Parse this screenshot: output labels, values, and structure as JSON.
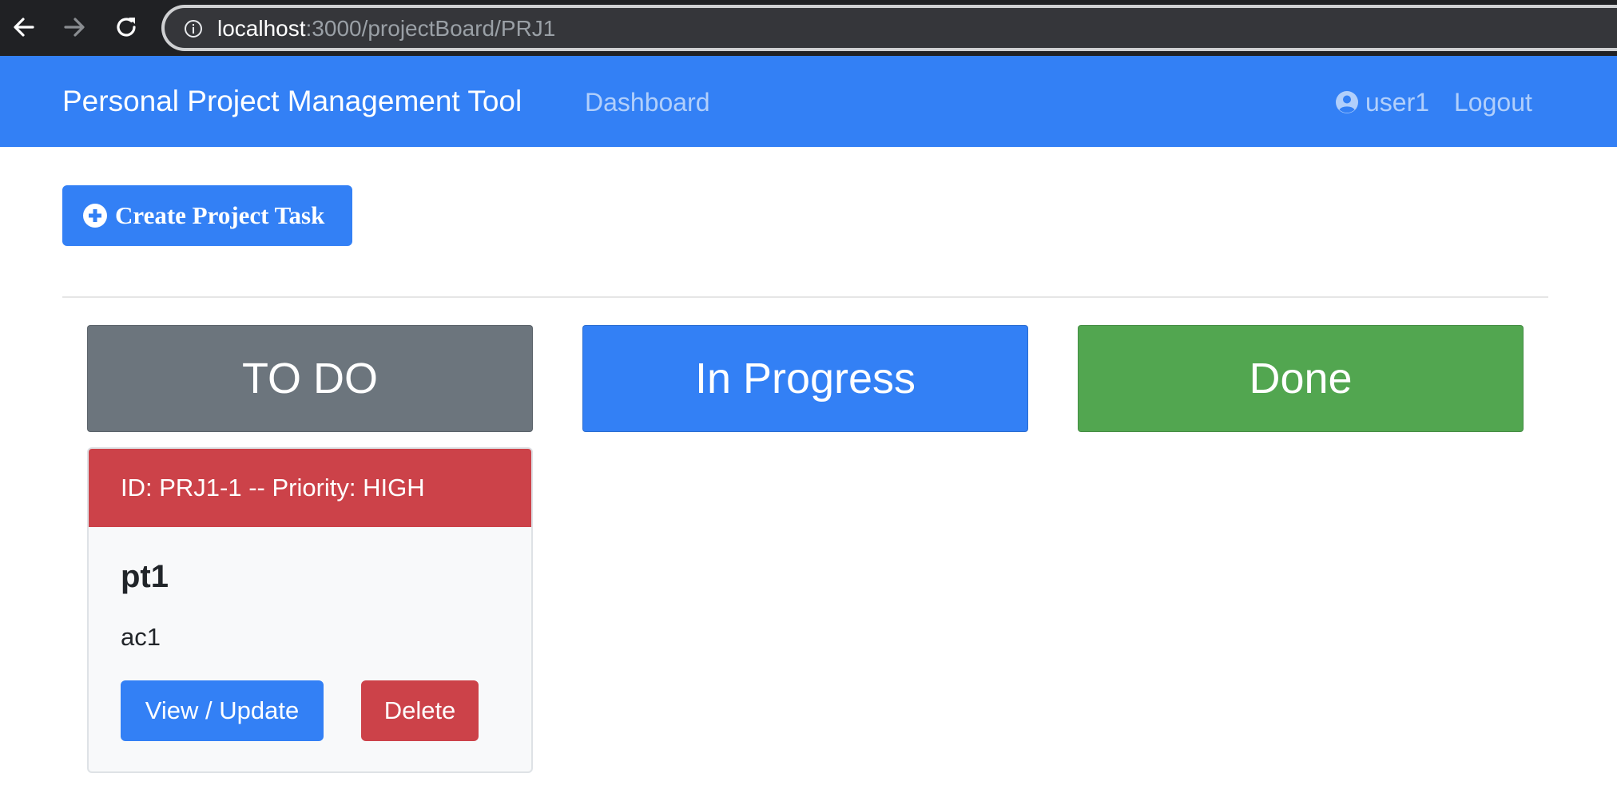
{
  "browser": {
    "url_host": "localhost",
    "url_path": ":3000/projectBoard/PRJ1"
  },
  "navbar": {
    "brand": "Personal Project Management Tool",
    "dashboard_label": "Dashboard",
    "username": "user1",
    "logout_label": "Logout",
    "background_color": "#3380f5"
  },
  "actions": {
    "create_task_label": "Create Project Task"
  },
  "columns": [
    {
      "label": "TO DO",
      "color": "#6c757d"
    },
    {
      "label": "In Progress",
      "color": "#3380f5"
    },
    {
      "label": "Done",
      "color": "#52a650"
    }
  ],
  "tasks": [
    {
      "header": "ID: PRJ1-1 -- Priority: HIGH",
      "summary": "pt1",
      "acceptance_criteria": "ac1",
      "view_label": "View / Update",
      "delete_label": "Delete",
      "priority_color": "#cc4249"
    }
  ],
  "icons": {
    "back": "arrow-left-icon",
    "forward": "arrow-right-icon",
    "reload": "reload-icon",
    "info": "info-icon",
    "user": "user-circle-icon",
    "plus": "plus-circle-icon"
  }
}
